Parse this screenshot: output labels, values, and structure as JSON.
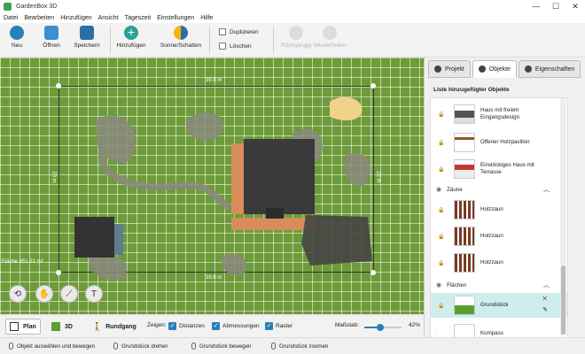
{
  "app": {
    "title": "GardenBox 3D"
  },
  "window_controls": {
    "minimize": "—",
    "maximize": "☐",
    "close": "✕"
  },
  "menu": [
    "Datei",
    "Bearbeiten",
    "Hinzufügen",
    "Ansicht",
    "Tageszeit",
    "Einstellungen",
    "Hilfe"
  ],
  "toolbar": {
    "new": "Neu",
    "open": "Öffnen",
    "save": "Speichern",
    "add": "Hinzufügen",
    "sun_shadow": "Sonne/Schatten",
    "duplicate": "Duplizieren",
    "delete": "Löschen",
    "undo": "Rückgängig",
    "redo": "Wiederholen"
  },
  "canvas": {
    "dim_top": "39.8 m",
    "dim_bottom": "39.8 m",
    "dim_left": "23 m",
    "dim_right": "22 m",
    "area": "Fläche 851.31 m²"
  },
  "side_panel": {
    "tabs": [
      "Projekt",
      "Objekte",
      "Eigenschaften"
    ],
    "active_tab": "Objekte",
    "list_header": "Liste hinzugefügter Objekte",
    "items": [
      {
        "name": "Haus mit freiem Eingangsdesign"
      },
      {
        "name": "Offener Holzpavillon"
      },
      {
        "name": "Einstöckiges Haus mit Terrasse"
      }
    ],
    "group_fences": "Zäune",
    "fences": [
      {
        "name": "Holzzaun"
      },
      {
        "name": "Holzzaun"
      },
      {
        "name": "Holzzaun"
      }
    ],
    "group_areas": "Flächen",
    "areas": [
      {
        "name": "Grundstück"
      },
      {
        "name": "Kompass"
      }
    ]
  },
  "viewbar": {
    "plan": "Plan",
    "three_d": "3D",
    "walk": "Rundgang",
    "show_label": "Zeigen:",
    "distances": "Distanzen",
    "dimensions": "Abmessungen",
    "grid": "Raster",
    "scale_label": "Maßstab:",
    "scale_value": "42%",
    "scale_fraction": 0.42
  },
  "status": [
    "Objekt auswählen und bewegen",
    "Grundstück drehen",
    "Grundstück bewegen",
    "Grundstück zoomen"
  ],
  "colors": {
    "lawn": "#6e9b39",
    "accent": "#2b7fb8",
    "selection": "#cdeeed"
  }
}
